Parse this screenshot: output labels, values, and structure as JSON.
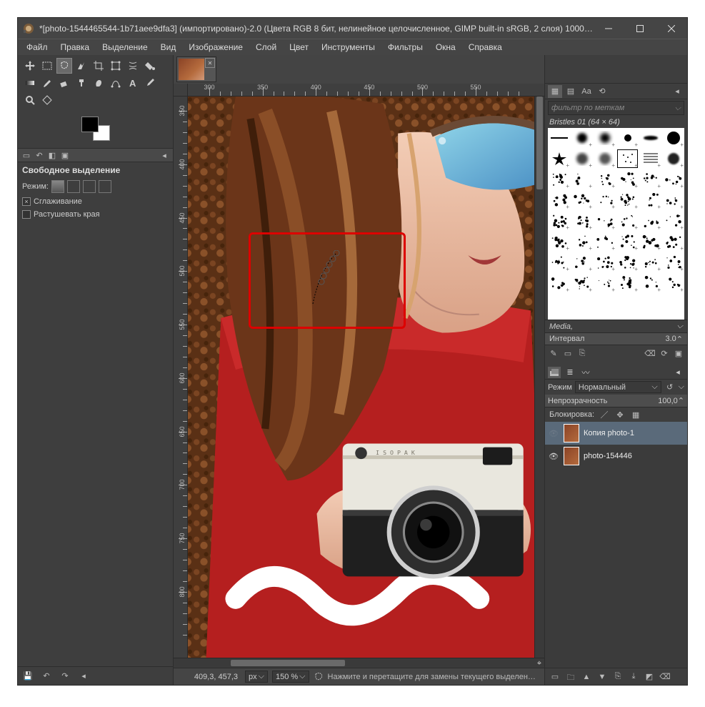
{
  "titlebar": {
    "title": "*[photo-1544465544-1b71aee9dfa3] (импортировано)-2.0 (Цвета RGB 8 бит, нелинейное целочисленное, GIMP built-in sRGB, 2 слоя) 1000…"
  },
  "menu": [
    "Файл",
    "Правка",
    "Выделение",
    "Вид",
    "Изображение",
    "Слой",
    "Цвет",
    "Инструменты",
    "Фильтры",
    "Окна",
    "Справка"
  ],
  "tool_options": {
    "title": "Свободное выделение",
    "mode_label": "Режим:",
    "antialias": "Сглаживание",
    "feather": "Растушевать края"
  },
  "brush": {
    "tag_placeholder": "фильтр по меткам",
    "name": "Bristles 01 (64 × 64)",
    "group": "Media,",
    "spacing_label": "Интервал",
    "spacing_value": "3.0"
  },
  "layers": {
    "mode_label": "Режим",
    "mode_value": "Нормальный",
    "opacity_label": "Непрозрачность",
    "opacity_value": "100,0",
    "lock_label": "Блокировка:",
    "items": [
      {
        "name": "Копия photo-1",
        "visible": false,
        "active": true
      },
      {
        "name": "photo-154446",
        "visible": true,
        "active": false
      }
    ]
  },
  "ruler_h": [
    "300",
    "350",
    "400",
    "450",
    "500",
    "550"
  ],
  "ruler_v": [
    "350",
    "400",
    "450",
    "500",
    "550",
    "600",
    "650",
    "700",
    "750",
    "800"
  ],
  "status": {
    "coord": "409,3, 457,3",
    "unit": "px",
    "zoom": "150 %",
    "message": "Нажмите и перетащите для замены текущего выделен…"
  }
}
